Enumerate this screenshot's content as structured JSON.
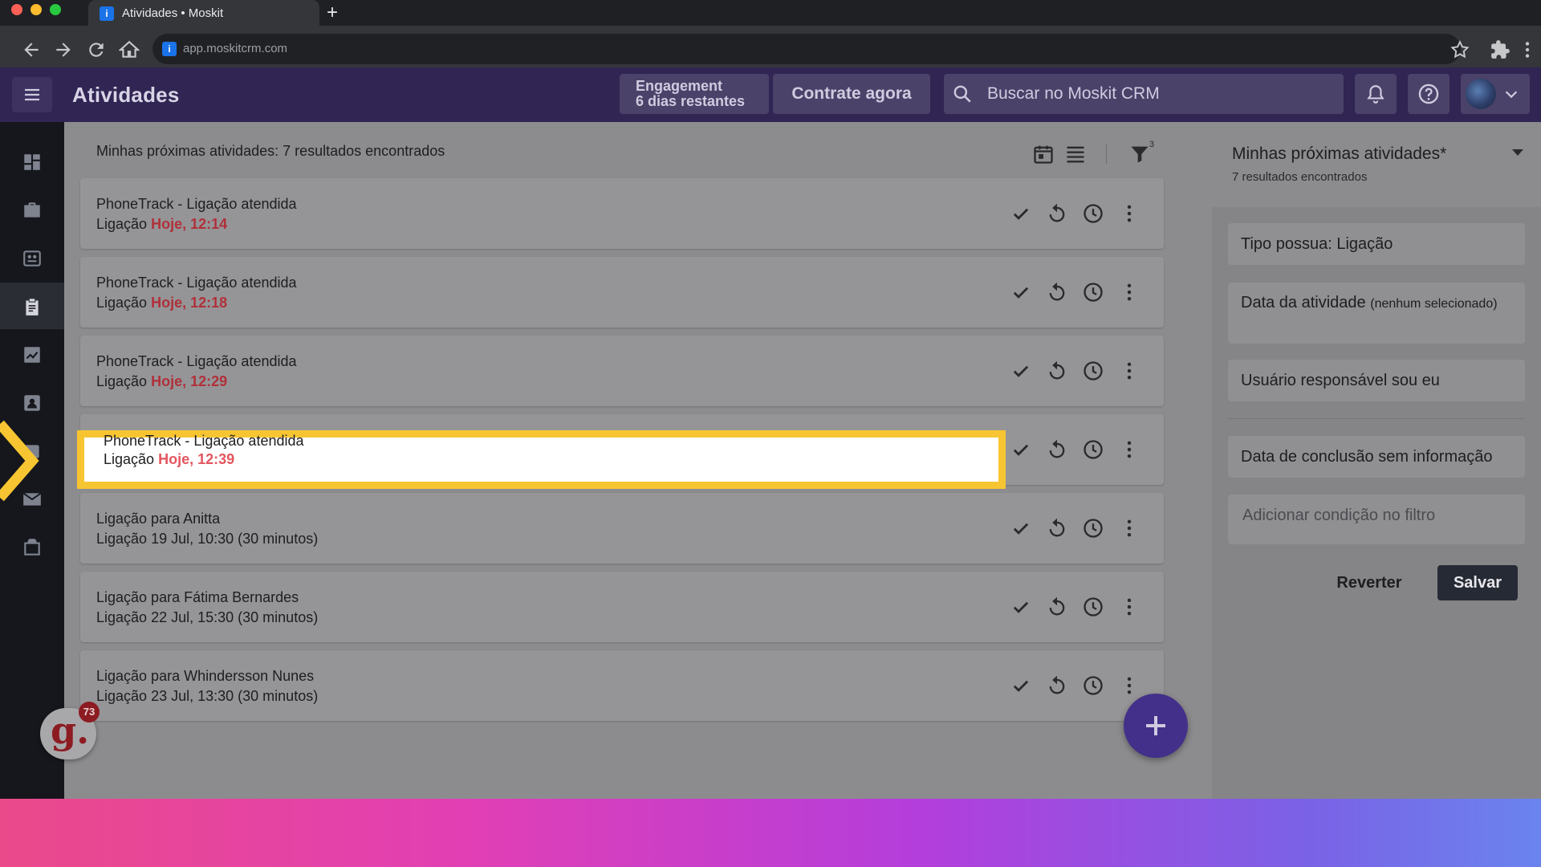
{
  "browser": {
    "tab_title": "Atividades • Moskit",
    "tab_favicon": "i",
    "url": "app.moskitcrm.com",
    "new_tab_label": "+"
  },
  "header": {
    "page_title": "Atividades",
    "engagement_title": "Engagement",
    "engagement_days": "6 dias restantes",
    "cta_label": "Contrate agora",
    "search_placeholder": "Buscar no Moskit CRM",
    "brand_color": "#302553"
  },
  "nav": {
    "items": [
      "dashboard-icon",
      "deals-briefcase-icon",
      "contacts-card-icon",
      "activities-clipboard-icon",
      "reports-chart-icon",
      "people-icon",
      "products-icon",
      "email-icon",
      "bag-icon"
    ],
    "active_item": "activities-clipboard-icon"
  },
  "list": {
    "result_label": "Minhas próximas atividades: 7 resultados encontrados",
    "filter_count": "3",
    "activities": [
      {
        "title": "PhoneTrack - Ligação atendida",
        "type": "Ligação",
        "due": "Hoje, 12:14",
        "overdue": true
      },
      {
        "title": "PhoneTrack - Ligação atendida",
        "type": "Ligação",
        "due": "Hoje, 12:18",
        "overdue": true
      },
      {
        "title": "PhoneTrack - Ligação atendida",
        "type": "Ligação",
        "due": "Hoje, 12:29",
        "overdue": true
      },
      {
        "title": "PhoneTrack - Ligação atendida",
        "type": "Ligação",
        "due": "Hoje, 12:39",
        "overdue": true,
        "highlighted": true
      },
      {
        "title": "Ligação para Anitta",
        "type": "Ligação",
        "due": "19 Jul, 10:30 (30 minutos)",
        "overdue": false
      },
      {
        "title": "Ligação para Fátima Bernardes",
        "type": "Ligação",
        "due": "22 Jul, 15:30 (30 minutos)",
        "overdue": false
      },
      {
        "title": "Ligação para Whindersson Nunes",
        "type": "Ligação",
        "due": "23 Jul, 13:30 (30 minutos)",
        "overdue": false
      }
    ],
    "overdue_color": "#e2565f",
    "highlight_color": "#f7c531"
  },
  "widget": {
    "letter": "g.",
    "badge": "73"
  },
  "filter_panel": {
    "title": "Minhas próximas atividades*",
    "subtitle": "7 resultados encontrados",
    "conditions": {
      "tipo": "Tipo possua: Ligação",
      "data_label": "Data da atividade",
      "data_note": "(nenhum selecionado)",
      "usuario": "Usuário responsável sou eu",
      "conclusao": "Data de conclusão sem informação"
    },
    "add_condition_placeholder": "Adicionar condição no filtro",
    "revert_label": "Reverter",
    "save_label": "Salvar"
  }
}
